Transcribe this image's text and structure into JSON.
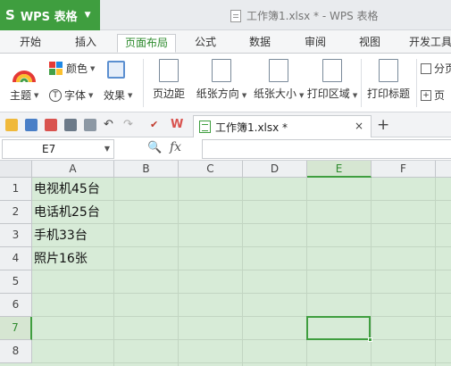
{
  "app": {
    "logo": "S",
    "name": "WPS 表格",
    "title": "工作簿1.xlsx * - WPS 表格"
  },
  "menu": {
    "tabs": [
      "开始",
      "插入",
      "页面布局",
      "公式",
      "数据",
      "审阅",
      "视图",
      "开发工具"
    ],
    "active": "页面布局"
  },
  "ribbon": {
    "theme": "主题",
    "colors": "颜色",
    "fonts": "字体",
    "effects": "效果",
    "margins": "页边距",
    "orientation": "纸张方向",
    "size": "纸张大小",
    "print_area": "打印区域",
    "print_titles": "打印标题",
    "page_break": "分页",
    "page_setup": "页"
  },
  "doc_tab": {
    "label": "工作簿1.xlsx *",
    "close": "×",
    "add": "+"
  },
  "formula_bar": {
    "name_box": "E7",
    "fx": "fx",
    "value": ""
  },
  "grid": {
    "columns": [
      "A",
      "B",
      "C",
      "D",
      "E",
      "F"
    ],
    "rows": [
      "1",
      "2",
      "3",
      "4",
      "5",
      "6",
      "7",
      "8"
    ],
    "selected_cell": "E7",
    "cells": {
      "A1": "电视机45台",
      "A2": "电话机25台",
      "A3": "手机33台",
      "A4": "照片16张"
    }
  },
  "colors": {
    "accent": "#3f9e3f",
    "sheet_bg": "#d7ebd7"
  }
}
